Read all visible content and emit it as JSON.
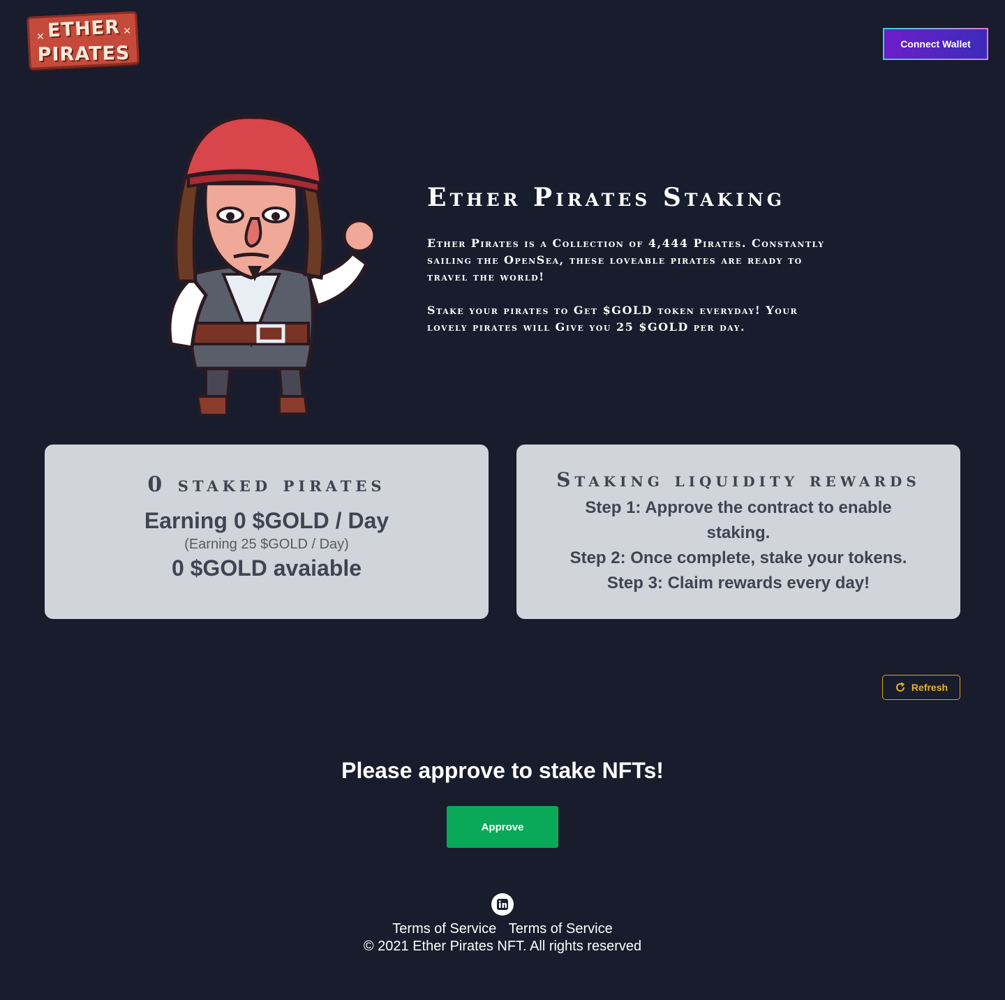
{
  "header": {
    "logo_line1": "ETHER",
    "logo_line2": "PIRATES",
    "connect_wallet_label": "Connect Wallet"
  },
  "hero": {
    "title": "Ether Pirates Staking",
    "paragraph1": "Ether Pirates is a Collection of 4,444 Pirates. Constantly sailing the OpenSea, these loveable pirates are ready to travel the world!",
    "paragraph2": "Stake your pirates to Get $GOLD token everyday! Your lovely pirates will Give you 25 $GOLD per day."
  },
  "staked_card": {
    "heading": "0 staked pirates",
    "earning": "Earning 0 $GOLD / Day",
    "earning_sub": "(Earning 25 $GOLD / Day)",
    "available": "0 $GOLD avaiable"
  },
  "rewards_card": {
    "heading": "Staking liquidity rewards",
    "step1": "Step 1: Approve the contract to enable staking.",
    "step2": "Step 2: Once complete, stake your tokens.",
    "step3": "Step 3: Claim rewards every day!"
  },
  "refresh_label": "Refresh",
  "approve_section": {
    "title": "Please approve to stake NFTs!",
    "button_label": "Approve"
  },
  "footer": {
    "links": [
      "Terms of Service",
      "Terms of Service"
    ],
    "copyright": "© 2021 Ether Pirates NFT. All rights reserved"
  },
  "colors": {
    "background": "#181c2c",
    "card": "#d1d4da",
    "approve": "#0aa95a",
    "refresh": "#e6b421",
    "wallet_gradient_start": "#6d1ec9"
  },
  "icons": [
    "linkedin-icon",
    "refresh-icon",
    "pirate-illustration"
  ]
}
